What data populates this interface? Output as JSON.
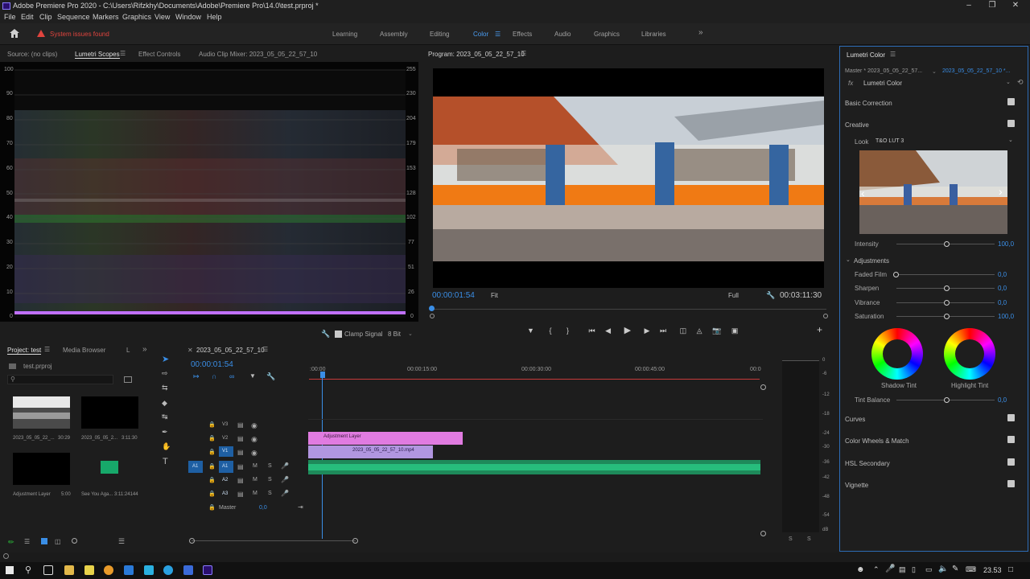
{
  "titlebar": {
    "title": "Adobe Premiere Pro 2020 - C:\\Users\\Rifzkhy\\Documents\\Adobe\\Premiere Pro\\14.0\\test.prproj *"
  },
  "menu": [
    "File",
    "Edit",
    "Clip",
    "Sequence",
    "Markers",
    "Graphics",
    "View",
    "Window",
    "Help"
  ],
  "workspace": {
    "warning": "System issues found",
    "tabs": [
      "Learning",
      "Assembly",
      "Editing",
      "Color",
      "Effects",
      "Audio",
      "Graphics",
      "Libraries"
    ],
    "active": "Color"
  },
  "source": {
    "tabs": [
      "Source: (no clips)",
      "Lumetri Scopes",
      "Effect Controls",
      "Audio Clip Mixer: 2023_05_05_22_57_10"
    ],
    "left_scale": [
      "100",
      "90",
      "80",
      "70",
      "60",
      "50",
      "40",
      "30",
      "20",
      "10",
      "0"
    ],
    "right_scale": [
      "255",
      "230",
      "204",
      "179",
      "153",
      "128",
      "102",
      "77",
      "51",
      "26",
      "0"
    ],
    "clamp": "Clamp Signal",
    "bit": "8 Bit"
  },
  "program": {
    "title": "Program: 2023_05_05_22_57_10",
    "timecode": "00:00:01:54",
    "fit": "Fit",
    "full": "Full",
    "duration": "00:03:11:30"
  },
  "lumetri": {
    "title": "Lumetri Color",
    "master": "Master * 2023_05_05_22_57...",
    "clip": "2023_05_05_22_57_10 *...",
    "fx": "Lumetri Color",
    "basic": "Basic Correction",
    "creative": "Creative",
    "look_label": "Look",
    "look": "T&O LUT 3",
    "intensity": {
      "label": "Intensity",
      "value": "100,0"
    },
    "adjustments": "Adjustments",
    "faded": {
      "label": "Faded Film",
      "value": "0,0"
    },
    "sharpen": {
      "label": "Sharpen",
      "value": "0,0"
    },
    "vibrance": {
      "label": "Vibrance",
      "value": "0,0"
    },
    "saturation": {
      "label": "Saturation",
      "value": "100,0"
    },
    "shadow": "Shadow Tint",
    "highlight": "Highlight Tint",
    "tint": {
      "label": "Tint Balance",
      "value": "0,0"
    },
    "sections": [
      "Curves",
      "Color Wheels & Match",
      "HSL Secondary",
      "Vignette"
    ]
  },
  "project": {
    "tabs": [
      "Project: test",
      "Media Browser",
      "L"
    ],
    "file": "test.prproj",
    "items": [
      {
        "name": "2023_05_05_22_...",
        "dur": "30:29"
      },
      {
        "name": "2023_05_05_2...",
        "dur": "3:11:30"
      },
      {
        "name": "Adjustment Layer",
        "dur": "5:00"
      },
      {
        "name": "See You Aga...",
        "dur": "3:11:24144"
      }
    ]
  },
  "timeline": {
    "title": "2023_05_05_22_57_10",
    "timecode": "00:00:01:54",
    "ruler": [
      ":00:00",
      "00:00:15:00",
      "00:00:30:00",
      "00:00:45:00",
      "00:0"
    ],
    "tracks": [
      {
        "label": "V3",
        "kind": "video"
      },
      {
        "label": "V2",
        "kind": "video"
      },
      {
        "label": "V1",
        "kind": "video"
      },
      {
        "label": "A1",
        "kind": "audio"
      },
      {
        "label": "A2",
        "kind": "audio"
      },
      {
        "label": "A3",
        "kind": "audio"
      }
    ],
    "master": "Master",
    "master_val": "0,0",
    "clip_adj": "Adjustment Layer",
    "clip_vid": "2023_05_05_22_57_10.mp4",
    "src_patch": "A1"
  },
  "meter": {
    "scale": [
      "0",
      "-6",
      "-12",
      "-18",
      "-24",
      "-30",
      "-36",
      "-42",
      "-48",
      "-54",
      "dB"
    ],
    "s1": "S",
    "s2": "S"
  },
  "taskbar": {
    "time": "23.53"
  }
}
